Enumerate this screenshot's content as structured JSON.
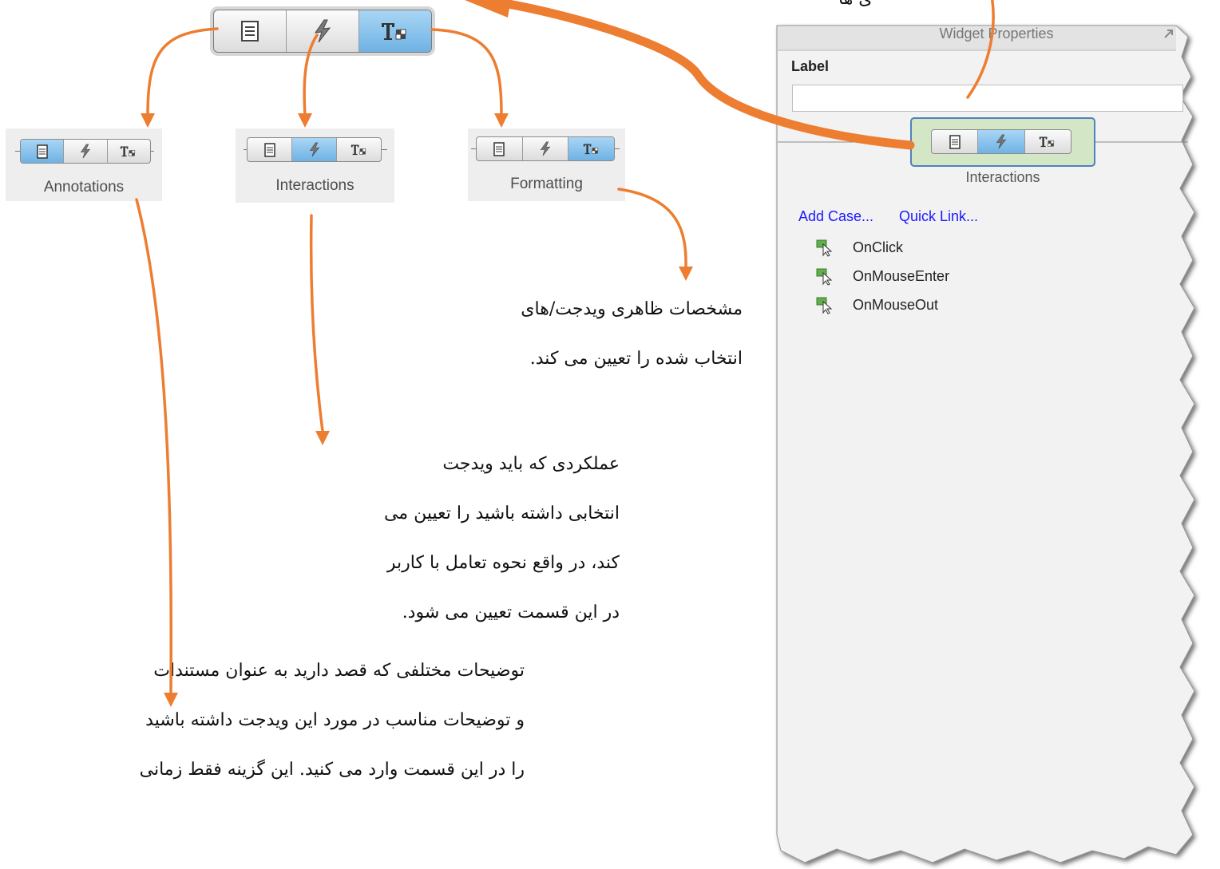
{
  "annotation_tabs": {
    "annotations_label": "Annotations",
    "interactions_label": "Interactions",
    "formatting_label": "Formatting"
  },
  "widget_properties": {
    "title": "Widget Properties",
    "label_heading": "Label",
    "label_value": "",
    "active_tab_label": "Interactions",
    "add_case": "Add Case...",
    "quick_link": "Quick Link...",
    "events": [
      "OnClick",
      "OnMouseEnter",
      "OnMouseOut"
    ]
  },
  "top_clip_text": "ی ها",
  "descriptions": {
    "formatting": [
      "مشخصات ظاهری ویدجت/های",
      "انتخاب شده را تعیین می کند."
    ],
    "interactions": [
      "عملکردی که باید ویدجت",
      "انتخابی داشته باشید را تعیین می",
      "کند، در واقع نحوه تعامل با کاربر",
      "در این قسمت تعیین می شود."
    ],
    "annotations": [
      "توضیحات مختلفی که قصد دارید به عنوان مستندات",
      "و توضیحات مناسب در مورد این ویدجت داشته باشید",
      "را در این قسمت وارد می کنید. این گزینه فقط زمانی"
    ]
  },
  "colors": {
    "arrow": "#ed7d31",
    "active_tab": "#7cb9e8",
    "link": "#1a1aff",
    "highlight": "#d3e7c6"
  },
  "icons": [
    "document-icon",
    "lightning-icon",
    "text-format-icon",
    "expand-icon",
    "interaction-cursor-icon"
  ]
}
